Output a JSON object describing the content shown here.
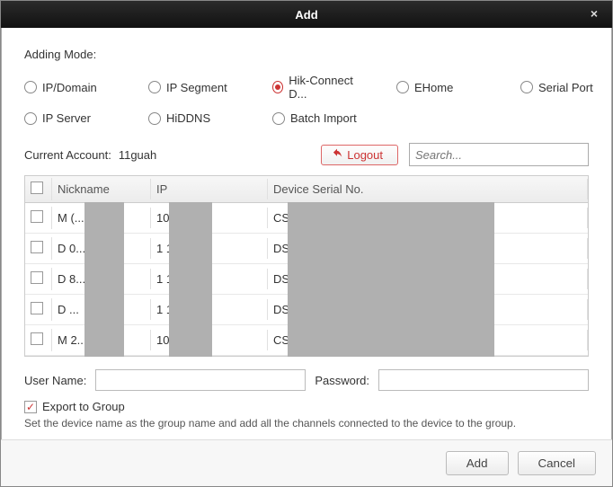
{
  "dialog": {
    "title": "Add"
  },
  "adding_mode": {
    "label": "Adding Mode:",
    "options": [
      "IP/Domain",
      "IP Segment",
      "Hik-Connect D...",
      "EHome",
      "Serial Port",
      "IP Server",
      "HiDDNS",
      "Batch Import"
    ],
    "selected_index": 2
  },
  "account": {
    "label": "Current Account:",
    "value": "11guah",
    "logout_label": "Logout",
    "search_placeholder": "Search..."
  },
  "table": {
    "headers": [
      "Nickname",
      "IP",
      "Device Serial No."
    ],
    "rows": [
      {
        "nickname": "M        (...",
        "ip": "10       .92",
        "serial": "CS-                              89588"
      },
      {
        "nickname": "D        0...",
        "ip": "1         18",
        "serial": "DS                               46843725"
      },
      {
        "nickname": "D        8...",
        "ip": "1         18",
        "serial": "DS                               1891952"
      },
      {
        "nickname": "D         ...",
        "ip": "1         18",
        "serial": "DS                               2418E"
      },
      {
        "nickname": "M        2...",
        "ip": "10       .92",
        "serial": "CS-"
      }
    ]
  },
  "form": {
    "username_label": "User Name:",
    "username_value": "",
    "password_label": "Password:",
    "password_value": "",
    "export_checked": true,
    "export_label": "Export to Group",
    "note_text": "Set the device name as the group name and add all the channels connected to the device to the group."
  },
  "footer": {
    "add_label": "Add",
    "cancel_label": "Cancel"
  }
}
